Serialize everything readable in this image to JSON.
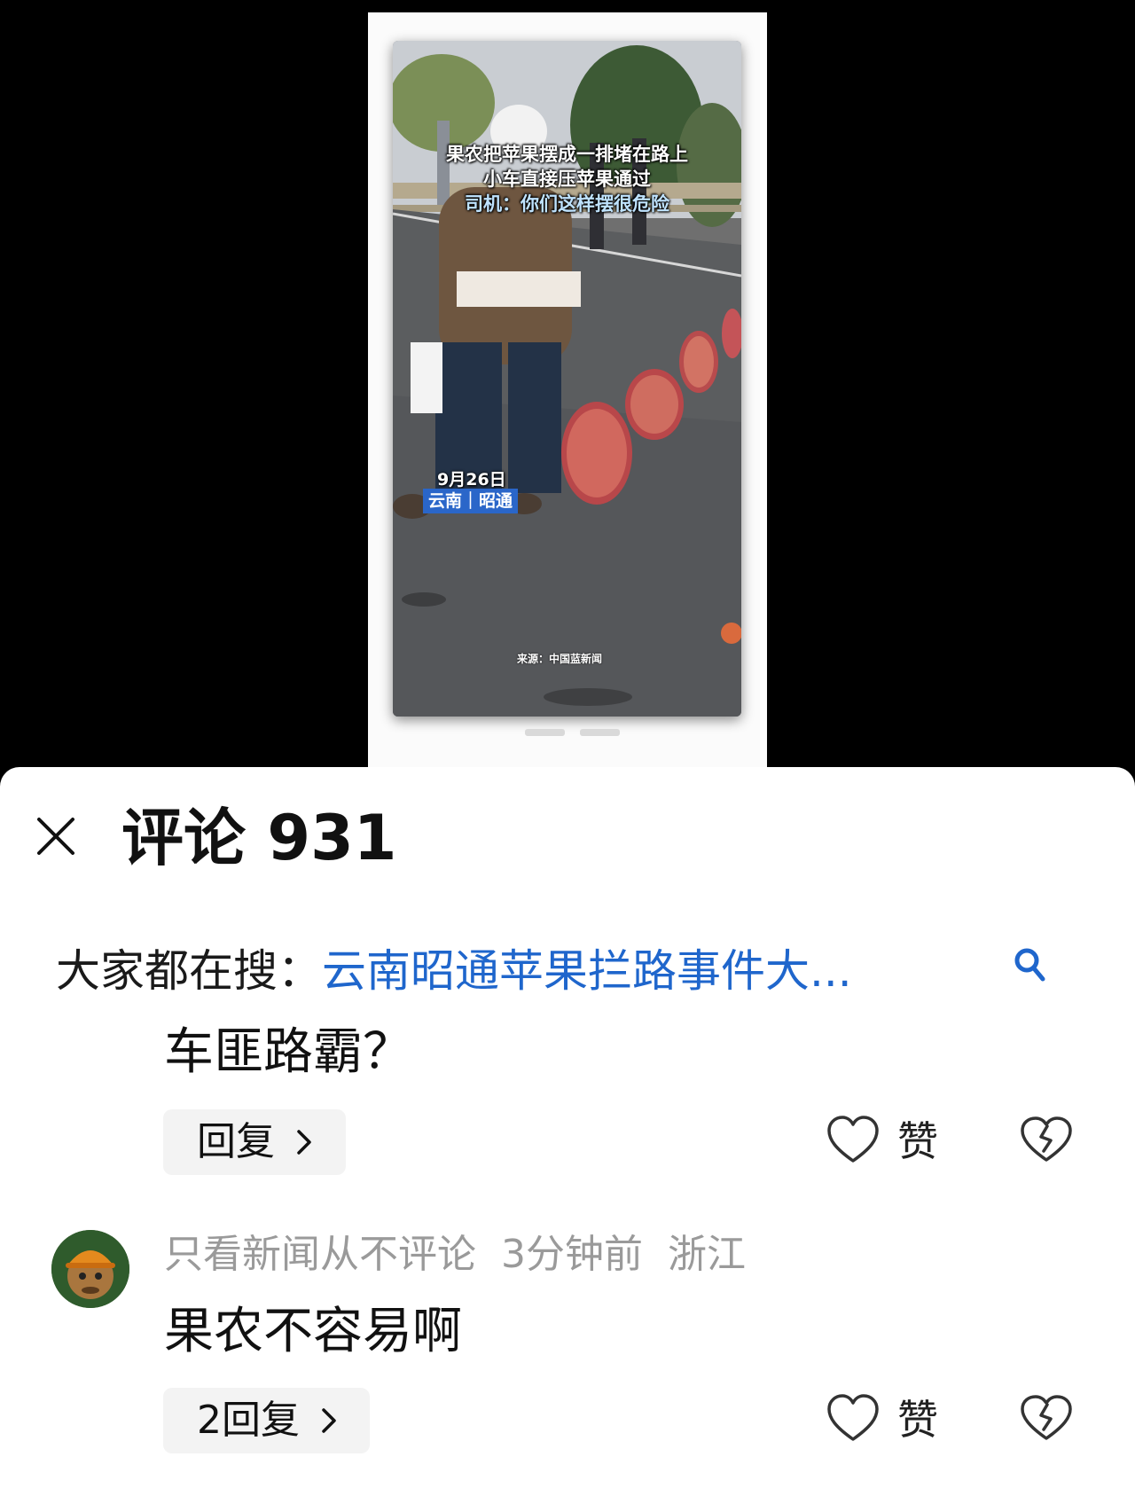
{
  "video": {
    "caption_line1": "果农把苹果摆成一排堵在路上",
    "caption_line2": "小车直接压苹果通过",
    "caption_line3": "司机：你们这样摆很危险",
    "date": "9月26日",
    "location": "云南｜昭通",
    "source": "来源：中国蓝新闻"
  },
  "comments_panel": {
    "title": "评论 931",
    "search_label": "大家都在搜：",
    "search_query": "云南昭通苹果拦路事件大...",
    "like_label": "赞",
    "comments": [
      {
        "text": "车匪路霸？",
        "reply_label": "回复"
      },
      {
        "username": "只看新闻从不评论",
        "time": "3分钟前",
        "region": "浙江",
        "text": "果农不容易啊",
        "reply_label": "2回复"
      }
    ]
  },
  "colors": {
    "search_query": "#1f66cc",
    "meta_text": "#9a9a9a",
    "location_badge": "#2a66c9"
  }
}
